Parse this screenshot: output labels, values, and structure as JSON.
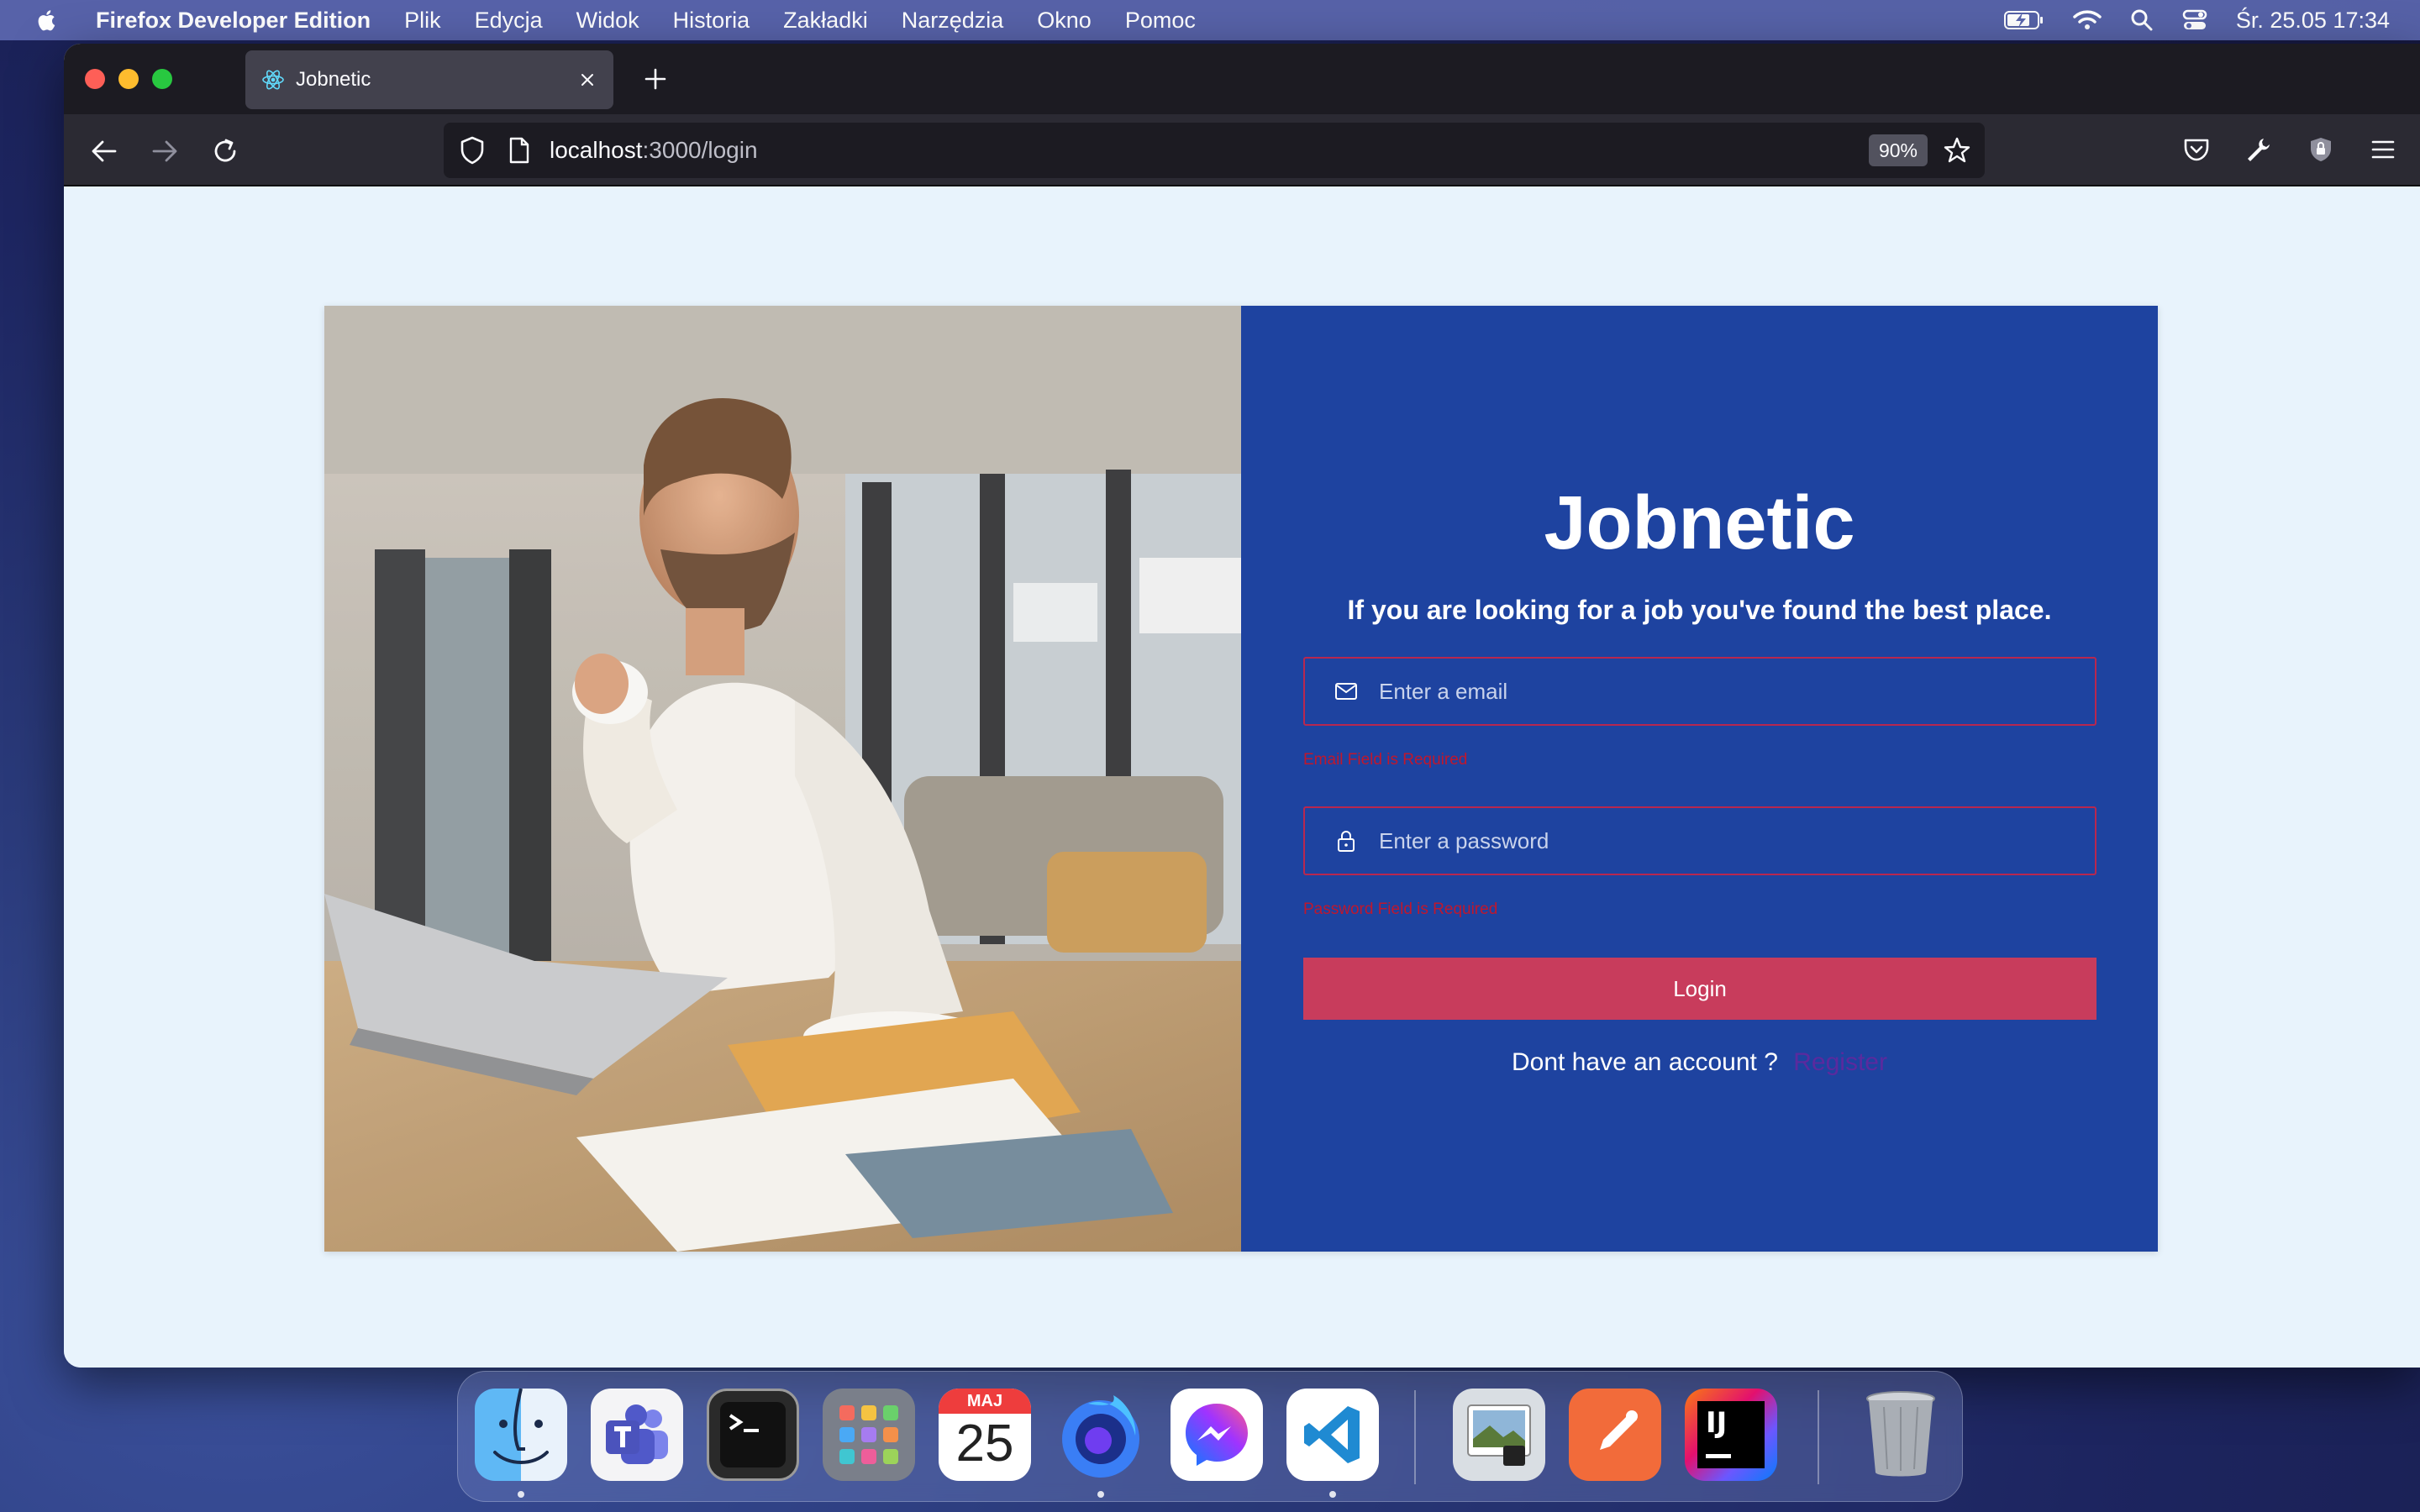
{
  "menubar": {
    "app_name": "Firefox Developer Edition",
    "items": [
      "Plik",
      "Edycja",
      "Widok",
      "Historia",
      "Zakładki",
      "Narzędzia",
      "Okno",
      "Pomoc"
    ],
    "datetime": "Śr. 25.05  17:34"
  },
  "browser": {
    "tab_title": "Jobnetic",
    "url_host": "localhost",
    "url_path": ":3000/login",
    "zoom": "90%"
  },
  "page": {
    "title": "Jobnetic",
    "subtitle": "If you are looking for a job you've found the best place.",
    "email_placeholder": "Enter a email",
    "email_error": "Email Field is Required",
    "password_placeholder": "Enter a password",
    "password_error": "Password Field is Required",
    "login_label": "Login",
    "no_account_text": "Dont have an account ?",
    "register_label": "Register"
  },
  "dock": {
    "calendar_month": "MAJ",
    "calendar_day": "25",
    "intellij_label": "IJ",
    "apps": [
      "finder-icon",
      "teams-icon",
      "terminal-icon",
      "launchpad-icon",
      "calendar-icon",
      "firefox-icon",
      "messenger-icon",
      "vscode-icon",
      "preview-icon",
      "postman-icon",
      "intellij-icon",
      "trash-icon"
    ]
  },
  "colors": {
    "form_panel": "#1e43a0",
    "login_button": "#c83c5c",
    "error_text": "#c0172d",
    "page_bg": "#e8f3fc"
  }
}
